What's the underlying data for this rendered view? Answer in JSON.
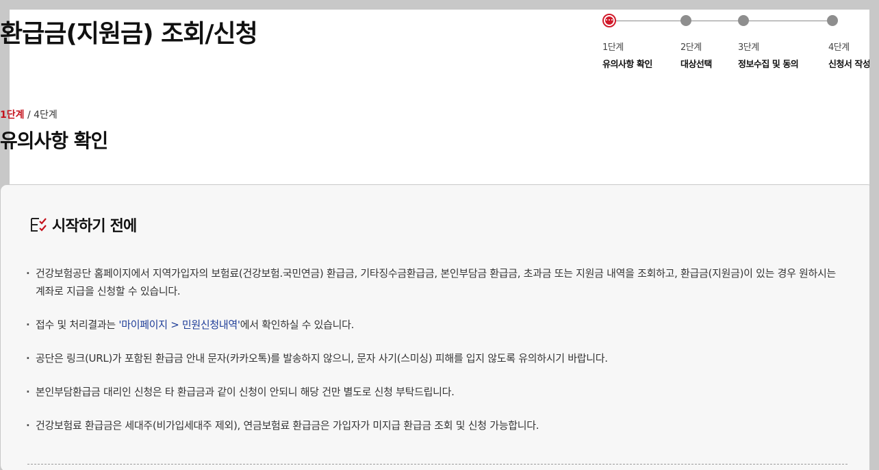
{
  "page": {
    "title": "환급금(지원금) 조회/신청"
  },
  "stepper": {
    "steps": [
      {
        "number": "1단계",
        "name": "유의사항 확인",
        "active": true
      },
      {
        "number": "2단계",
        "name": "대상선택",
        "active": false
      },
      {
        "number": "3단계",
        "name": "정보수집 및 동의",
        "active": false
      },
      {
        "number": "4단계",
        "name": "신청서 작성",
        "active": false
      }
    ],
    "active_color": "#d11a2a",
    "inactive_color": "#8e8e8e"
  },
  "progress": {
    "current": "1단계",
    "separator": " / ",
    "total": "4단계"
  },
  "section": {
    "title": "유의사항 확인"
  },
  "notice": {
    "icon": "checklist-icon",
    "title": "시작하기 전에",
    "items": [
      {
        "text": "건강보험공단 홈페이지에서 지역가입자의 보험료(건강보험.국민연금) 환급금, 기타징수금환급금, 본인부담금 환급금, 초과금 또는 지원금 내역을 조회하고, 환급금(지원금)이 있는 경우 원하시는 계좌로 지급을 신청할 수 있습니다."
      },
      {
        "prefix": "접수 및 처리결과는 ",
        "link": "'마이페이지 > 민원신청내역'",
        "suffix": "에서 확인하실 수 있습니다."
      },
      {
        "text": "공단은 링크(URL)가 포함된 환급금 안내 문자(카카오톡)를 발송하지 않으니, 문자 사기(스미싱) 피해를 입지 않도록 유의하시기 바랍니다."
      },
      {
        "text": "본인부담환급금 대리인 신청은 타 환급금과 같이 신청이 안되니 해당 건만 별도로 신청 부탁드립니다."
      },
      {
        "text": "건강보험료 환급금은 세대주(비가입세대주 제외), 연금보험료 환급금은 가입자가 미지급 환급금 조회 및 신청 가능합니다."
      }
    ],
    "link_color": "#1d3c98",
    "accent_color": "#c4121c"
  }
}
